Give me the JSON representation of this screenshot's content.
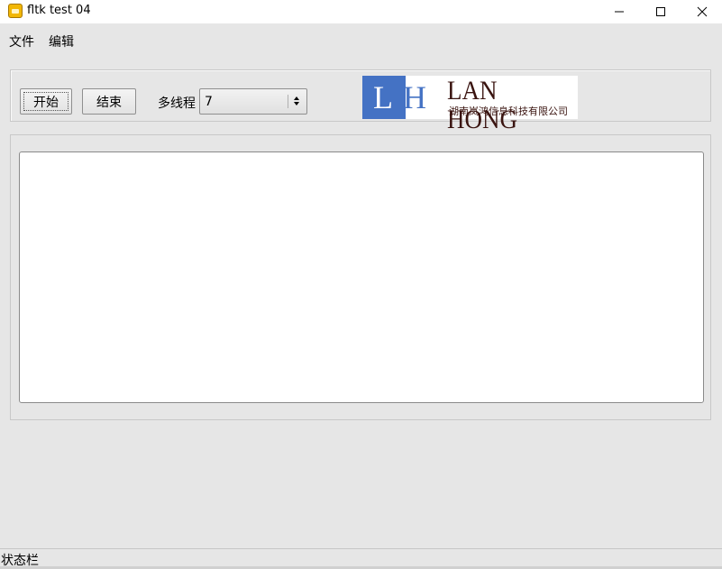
{
  "window": {
    "title": "fltk test 04",
    "icon": "app-icon",
    "controls": [
      "minimize-icon",
      "maximize-icon",
      "close-icon"
    ]
  },
  "menu": {
    "items": [
      {
        "label": "文件"
      },
      {
        "label": "编辑"
      }
    ]
  },
  "toolbar": {
    "start_label": "开始",
    "end_label": "结束",
    "thread_label": "多线程",
    "thread_value": "7"
  },
  "logo": {
    "letter_l": "L",
    "letter_h": "H",
    "title": "LAN HONG",
    "subtitle": "湖南岚鸿信息科技有限公司",
    "colors": {
      "box": "#4472c4",
      "text": "#3a1410"
    }
  },
  "output": {
    "text": ""
  },
  "status": {
    "text": "状态栏"
  }
}
